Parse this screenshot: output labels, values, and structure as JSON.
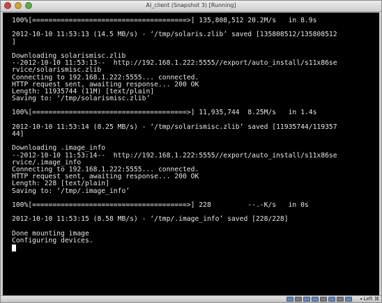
{
  "window": {
    "title": "AI_client (Snapshot 3) [Running]"
  },
  "terminal": {
    "lines": [
      "100%[======================================>] 135,808,512 20.2M/s   in 8.9s",
      "",
      "2012-10-10 11:53:13 (14.5 MB/s) - ‘/tmp/solaris.zlib’ saved [135808512/135808512",
      "]",
      "",
      "Downloading solarismisc.zlib",
      "--2012-10-10 11:53:13--  http://192.168.1.222:5555//export/auto_install/s11x86se",
      "rvice/solarismisc.zlib",
      "Connecting to 192.168.1.222:5555... connected.",
      "HTTP request sent, awaiting response... 200 OK",
      "Length: 11935744 (11M) [text/plain]",
      "Saving to: ‘/tmp/solarismisc.zlib’",
      "",
      "100%[======================================>] 11,935,744  8.25M/s   in 1.4s",
      "",
      "2012-10-10 11:53:14 (8.25 MB/s) - ‘/tmp/solarismisc.zlib’ saved [11935744/119357",
      "44]",
      "",
      "Downloading .image_info",
      "--2012-10-10 11:53:14--  http://192.168.1.222:5555//export/auto_install/s11x86se",
      "rvice/.image_info",
      "Connecting to 192.168.1.222:5555... connected.",
      "HTTP request sent, awaiting response... 200 OK",
      "Length: 228 [text/plain]",
      "Saving to: ‘/tmp/.image_info’",
      "",
      "100%[======================================>] 228         --.-K/s   in 0s",
      "",
      "2012-10-10 11:53:15 (8.58 MB/s) - ‘/tmp/.image_info’ saved [228/228]",
      "",
      "Done mounting image",
      "Configuring devices."
    ]
  },
  "statusbar": {
    "icons": [
      "hard-disk-icon",
      "optical-drive-icon",
      "usb-icon",
      "network-icon",
      "shared-folders-icon",
      "display-icon",
      "camera-icon",
      "mouse-integration-icon"
    ],
    "host_key_label": "Left ⌘"
  }
}
